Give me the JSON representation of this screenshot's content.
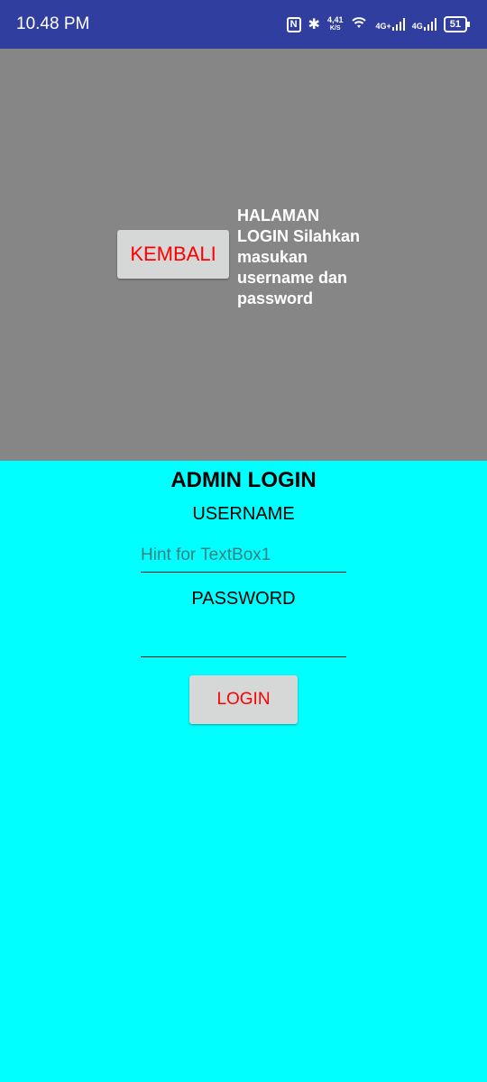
{
  "status_bar": {
    "time": "10.48 PM",
    "nfc_icon": "N",
    "bluetooth_icon": "✱",
    "network_speed_value": "4,41",
    "network_speed_unit": "K/S",
    "wifi_icon": "wifi",
    "signal1_label": "4G+",
    "signal2_label": "4G",
    "battery": "51"
  },
  "header": {
    "back_label": "KEMBALI",
    "info_text": "HALAMAN LOGIN Silahkan masukan username dan password"
  },
  "login": {
    "title": "ADMIN LOGIN",
    "username_label": "USERNAME",
    "username_placeholder": "Hint for TextBox1",
    "username_value": "",
    "password_label": "PASSWORD",
    "password_value": "",
    "login_button": "LOGIN"
  },
  "colors": {
    "status_bar": "#303f9f",
    "header_panel": "#868686",
    "background": "#00ffff",
    "button_bg": "#d6d7d7",
    "button_text": "#ff0000"
  }
}
